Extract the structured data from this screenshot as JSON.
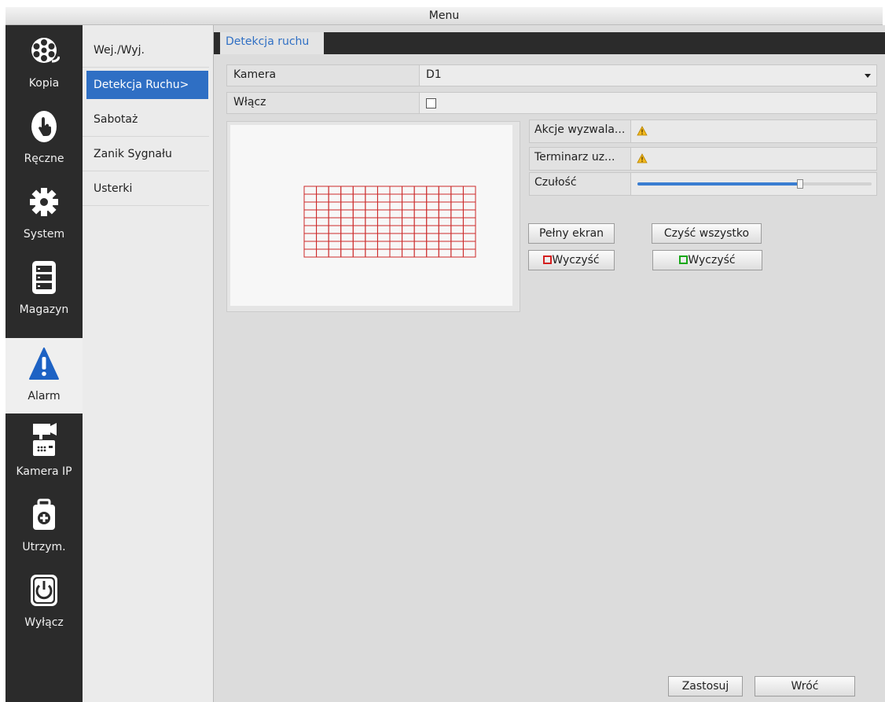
{
  "window": {
    "title": "Menu"
  },
  "nav": [
    {
      "label": "Kopia",
      "icon": "film-reel-icon"
    },
    {
      "label": "Ręczne",
      "icon": "hand-icon"
    },
    {
      "label": "System",
      "icon": "gear-icon"
    },
    {
      "label": "Magazyn",
      "icon": "storage-icon"
    },
    {
      "label": "Alarm",
      "icon": "alarm-warning-icon",
      "active": true
    },
    {
      "label": "Kamera IP",
      "icon": "ip-camera-icon"
    },
    {
      "label": "Utrzym.",
      "icon": "maintenance-case-icon"
    },
    {
      "label": "Wyłącz",
      "icon": "power-icon"
    }
  ],
  "submenu": [
    {
      "label": "Wej./Wyj."
    },
    {
      "label": "Detekcja Ruchu>",
      "active": true
    },
    {
      "label": "Sabotaż"
    },
    {
      "label": "Zanik Sygnału"
    },
    {
      "label": "Usterki"
    }
  ],
  "tab": {
    "label": "Detekcja ruchu"
  },
  "form": {
    "camera_label": "Kamera",
    "camera_value": "D1",
    "enable_label": "Włącz",
    "enable_checked": false
  },
  "detection_grid": {
    "rows": 9,
    "cols": 14,
    "line_color": "#cc2a2a"
  },
  "props": {
    "trigger_label": "Akcje wyzwala...",
    "schedule_label": "Terminarz uz...",
    "sensitivity_label": "Czułość",
    "sensitivity_fraction": 0.69
  },
  "buttons": {
    "fullscreen": "Pełny ekran",
    "clear_all": "Czyść wszystko",
    "clear_red": "Wyczyść",
    "clear_green": "Wyczyść",
    "apply": "Zastosuj",
    "back": "Wróć"
  },
  "colors": {
    "accent": "#2f6fc4",
    "nav_bg": "#2b2b2b",
    "red_zone": "#d42020",
    "green_zone": "#18a818"
  }
}
